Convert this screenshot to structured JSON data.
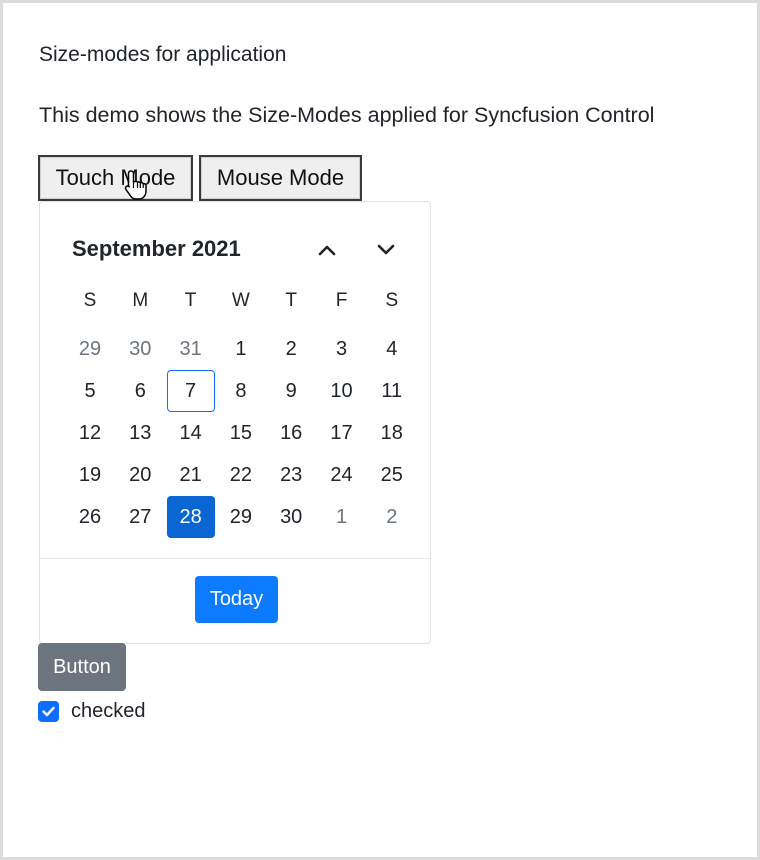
{
  "page": {
    "heading": "Size-modes for application",
    "description": "This demo shows the Size-Modes applied for Syncfusion Control"
  },
  "mode_buttons": {
    "touch": "Touch Mode",
    "mouse": "Mouse Mode"
  },
  "calendar": {
    "title": "September 2021",
    "prev_icon": "chevron-up-icon",
    "next_icon": "chevron-down-icon",
    "weekdays": [
      "S",
      "M",
      "T",
      "W",
      "T",
      "F",
      "S"
    ],
    "weeks": [
      [
        "29",
        "30",
        "31",
        "1",
        "2",
        "3",
        "4"
      ],
      [
        "5",
        "6",
        "7",
        "8",
        "9",
        "10",
        "11"
      ],
      [
        "12",
        "13",
        "14",
        "15",
        "16",
        "17",
        "18"
      ],
      [
        "19",
        "20",
        "21",
        "22",
        "23",
        "24",
        "25"
      ],
      [
        "26",
        "27",
        "28",
        "29",
        "30",
        "1",
        "2"
      ]
    ],
    "today_date": "7",
    "selected_date": "28",
    "today_button": "Today"
  },
  "button": {
    "label": "Button"
  },
  "checkbox": {
    "label": "checked",
    "checked": true
  },
  "colors": {
    "primary": "#0d7bff",
    "selected": "#0a66d2",
    "secondary": "#6c757d"
  }
}
